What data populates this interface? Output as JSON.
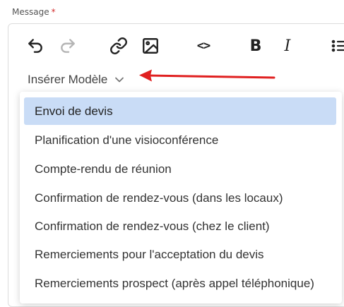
{
  "field": {
    "label": "Message",
    "required_mark": "*"
  },
  "toolbar": {
    "buttons": [
      {
        "name": "undo",
        "icon": "undo-icon"
      },
      {
        "name": "redo",
        "icon": "redo-icon"
      },
      {
        "name": "link",
        "icon": "link-icon"
      },
      {
        "name": "image",
        "icon": "image-icon"
      },
      {
        "name": "code",
        "icon": "code-icon",
        "glyph": "<>"
      },
      {
        "name": "bold",
        "icon": "bold-icon",
        "glyph": "B"
      },
      {
        "name": "italic",
        "icon": "italic-icon",
        "glyph": "I"
      },
      {
        "name": "list",
        "icon": "list-icon"
      }
    ]
  },
  "insert_template": {
    "label": "Insérer Modèle",
    "icon": "chevron-down-icon"
  },
  "annotation": {
    "arrow_color": "#e02020"
  },
  "dropdown": {
    "selected_color": "#c9dcf6",
    "items": [
      {
        "label": "Envoi de devis",
        "selected": true
      },
      {
        "label": "Planification d'une visioconférence",
        "selected": false
      },
      {
        "label": "Compte-rendu de réunion",
        "selected": false
      },
      {
        "label": "Confirmation de rendez-vous (dans les locaux)",
        "selected": false
      },
      {
        "label": "Confirmation de rendez-vous (chez le client)",
        "selected": false
      },
      {
        "label": "Remerciements pour l'acceptation du devis",
        "selected": false
      },
      {
        "label": "Remerciements prospect (après appel téléphonique)",
        "selected": false
      }
    ]
  }
}
